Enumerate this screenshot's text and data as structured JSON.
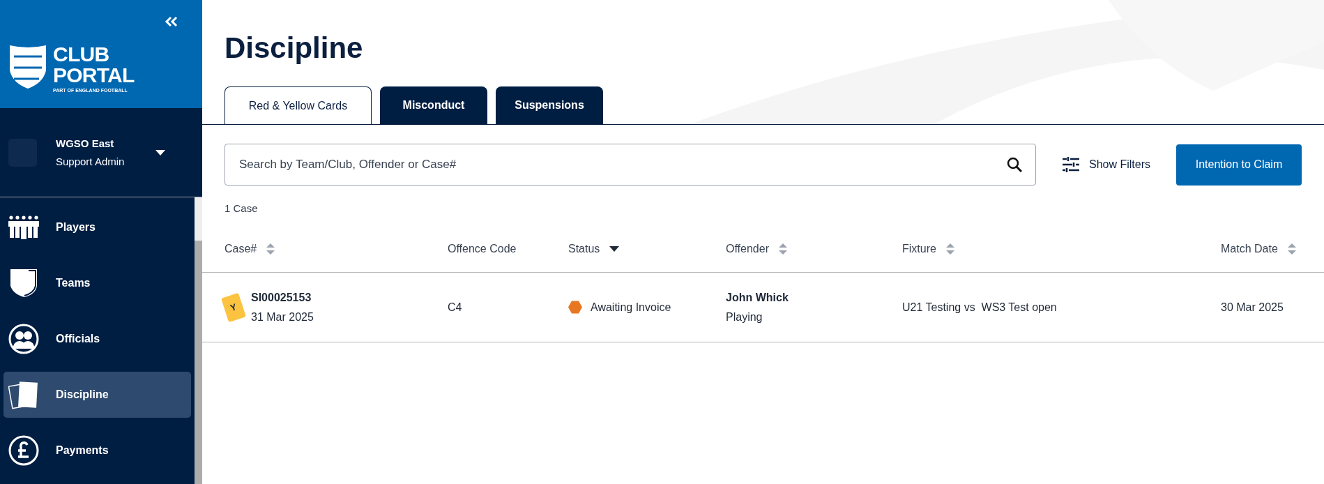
{
  "sidebar": {
    "brand": {
      "title_line_1": "CLUB",
      "title_line_2": "PORTAL",
      "tagline": "PART OF ENGLAND FOOTBALL"
    },
    "account": {
      "name": "WGSO East",
      "role": "Support Admin"
    },
    "items": [
      {
        "label": "Players",
        "selected": false
      },
      {
        "label": "Teams",
        "selected": false
      },
      {
        "label": "Officials",
        "selected": false
      },
      {
        "label": "Discipline",
        "selected": true
      },
      {
        "label": "Payments",
        "selected": false
      }
    ]
  },
  "page_title": "Discipline",
  "tabs": [
    {
      "label": "Red & Yellow Cards",
      "selected": true
    },
    {
      "label": "Misconduct",
      "selected": false
    },
    {
      "label": "Suspensions",
      "selected": false
    }
  ],
  "search": {
    "placeholder": "Search by Team/Club, Offender or Case#"
  },
  "show_filters": "Show Filters",
  "primary_button": "Intention to Claim",
  "result_count": "1 Case",
  "table": {
    "columns": [
      {
        "label": "Case#",
        "sortable": true,
        "sorted": false
      },
      {
        "label": "Offence Code",
        "sortable": false,
        "sorted": false
      },
      {
        "label": "Status",
        "sortable": true,
        "sorted": true
      },
      {
        "label": "Offender",
        "sortable": true,
        "sorted": false
      },
      {
        "label": "Fixture",
        "sortable": true,
        "sorted": false
      },
      {
        "label": "Match Date",
        "sortable": true,
        "sorted": false
      }
    ],
    "rows": [
      {
        "card": {
          "letter": "Y",
          "color": "#fcc341"
        },
        "case": "SI00025153",
        "case_date": "31 Mar 2025",
        "offence_code": "C4",
        "status": {
          "label": "Awaiting Invoice",
          "color": "#e87722"
        },
        "offender": "John Whick",
        "offender_role": "Playing",
        "fixture": "U21 Testing vs  WS3 Test open",
        "match_date": "30 Mar 2025"
      }
    ]
  }
}
